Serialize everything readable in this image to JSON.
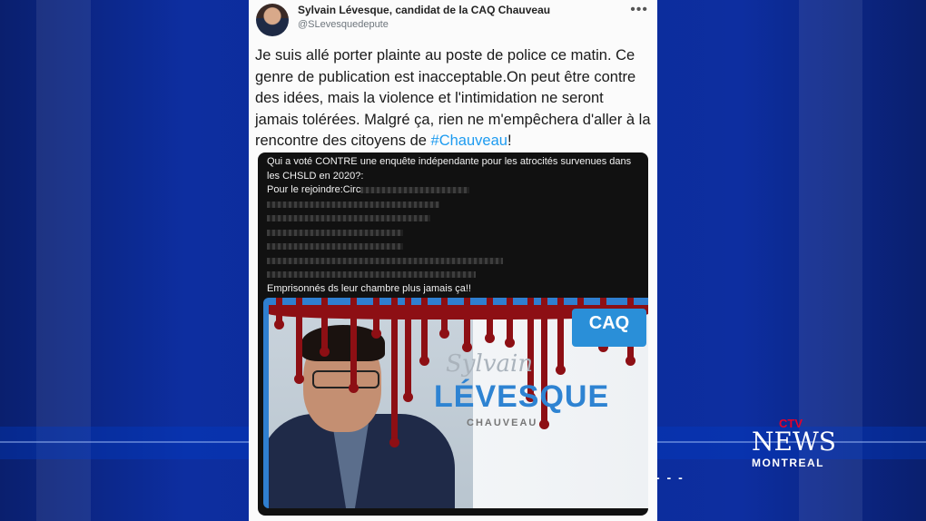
{
  "tweet": {
    "author_name": "Sylvain Lévesque, candidat de la CAQ Chauveau",
    "author_handle": "@SLevesquedepute",
    "more_icon": "more-horizontal-icon",
    "text_main": "Je suis allé porter plainte au poste de police ce matin. Ce genre de publication est inacceptable.On peut être contre des idées, mais la violence et l'intimidation ne seront jamais tolérées. Malgré ça, rien ne m'empêchera d'aller à la rencontre des citoyens de ",
    "hashtag": "#Chauveau",
    "text_end": "!"
  },
  "media": {
    "line1": "Qui a voté CONTRE une enquête indépendante pour les atrocités survenues dans les CHSLD en 2020?:",
    "line2": "Pour le rejoindre:Circ",
    "line_last": "Emprisonnés ds leur chambre plus jamais ça!!",
    "poster": {
      "signature": "Sylvain",
      "name": "LÉVESQUE",
      "riding": "CHAUVEAU",
      "party_logo": "CAQ"
    }
  },
  "broadcast": {
    "network": "CTV",
    "news": "NEWS",
    "city": "MONTREAL",
    "dashes": "- - -",
    "colors": {
      "c": "#e4002b",
      "t": "#0072ce",
      "v": "#6cc24a"
    }
  }
}
